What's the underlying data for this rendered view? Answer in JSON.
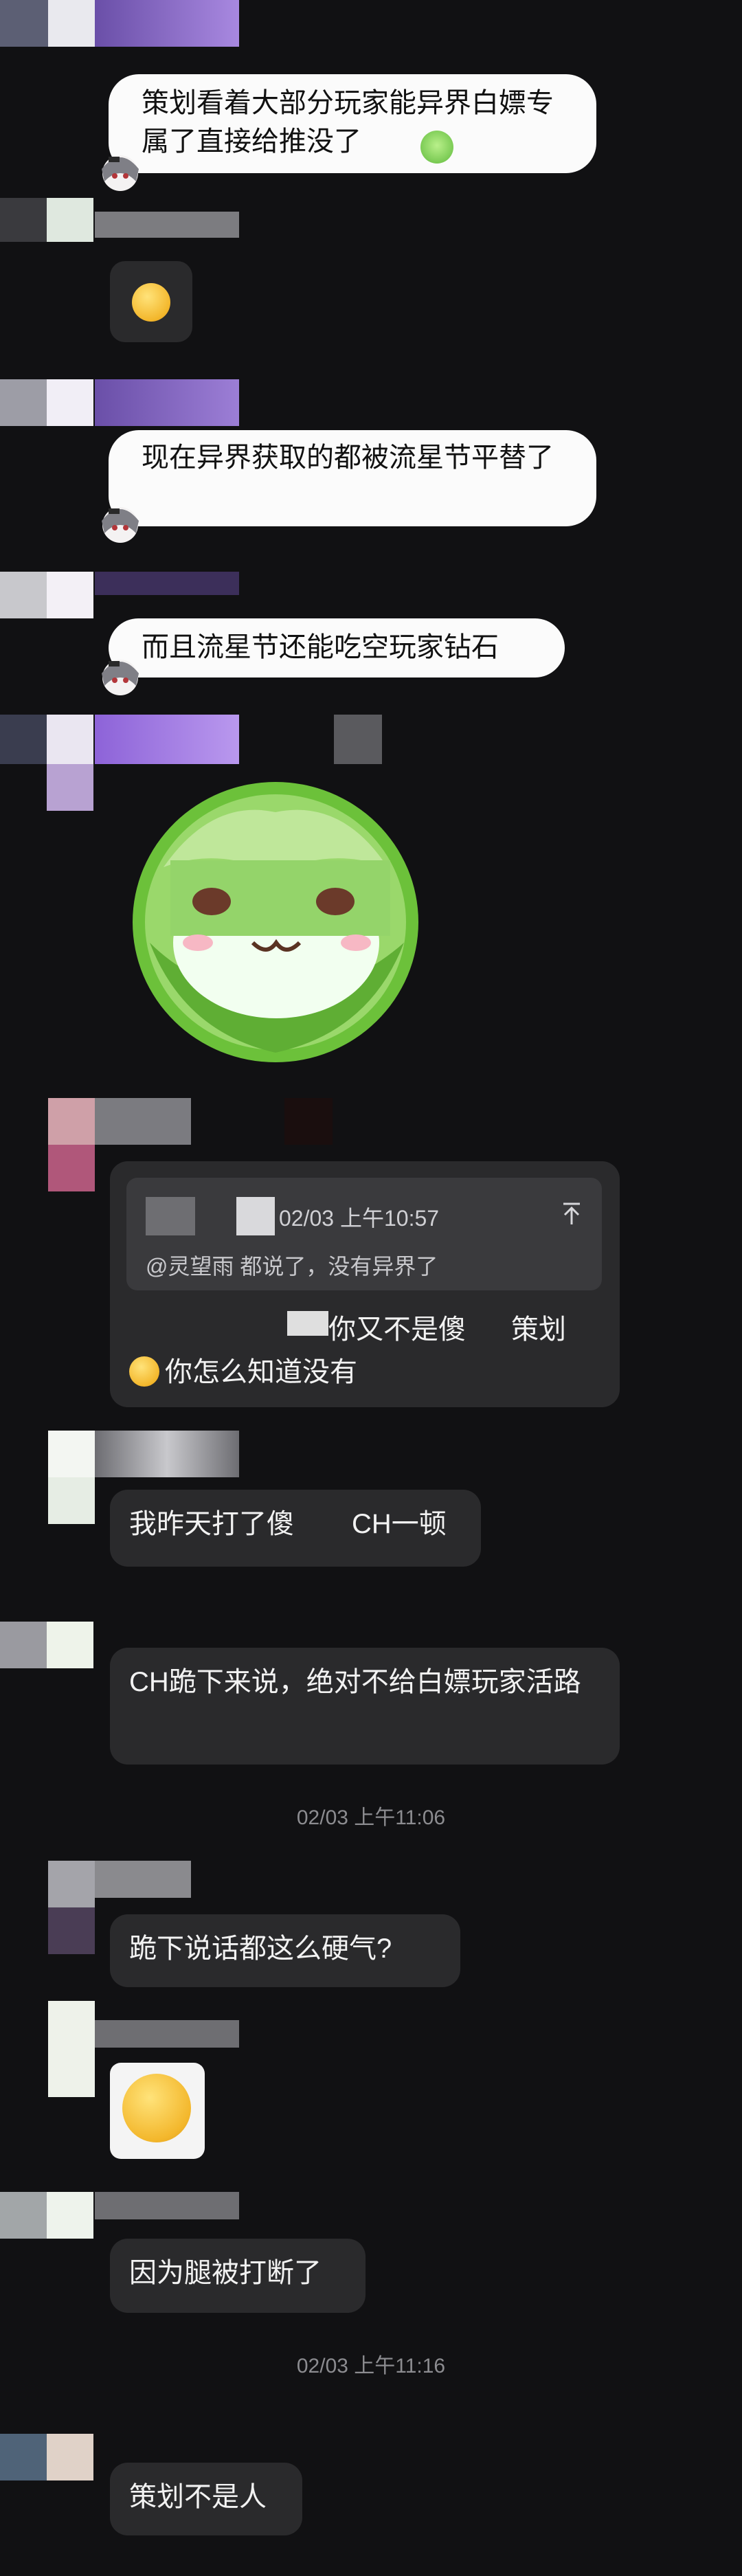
{
  "messages": {
    "m1_text": "策划看着大部分玩家能异界白嫖专属了直接给推没了",
    "m3_text": "现在异界获取的都被流星节平替了",
    "m4_text": "而且流星节还能吃空玩家钻石",
    "quote_time": "02/03 上午10:57",
    "quote_text": "@灵望雨 都说了，没有异界了",
    "reply_line1": "你又不是傻",
    "reply_line1b": "策划",
    "reply_line2": "你怎么知道没有",
    "m7_text": "我昨天打了傻",
    "m7_text_b": "CH一顿",
    "m8_text": "CH跪下来说，绝对不给白嫖玩家活路",
    "ts1": "02/03 上午11:06",
    "m9_text": "跪下说话都这么硬气?",
    "m11_text": "因为腿被打断了",
    "ts2": "02/03 上午11:16",
    "m12_text": "策划不是人"
  },
  "icons": {
    "quote_jump": "arrow-up-to-top-icon",
    "smile_emoji": "grinning-face-emoji",
    "cabbage_sticker": "cabbage-character-sticker",
    "avatar_decoration": "chibi-girl-avatar-decoration"
  },
  "colors": {
    "background": "#111113",
    "dark_bubble": "#2a2a2c",
    "white_bubble": "#fbfbfb",
    "timestamp": "#8c8c90"
  }
}
